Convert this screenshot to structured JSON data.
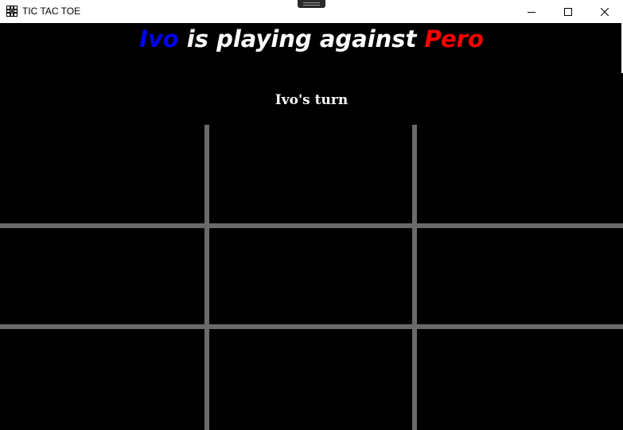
{
  "window": {
    "title": "TIC TAC TOE",
    "icon": "tic-tac-toe-grid-icon",
    "controls": [
      "minimize-icon",
      "maximize-icon",
      "close-icon"
    ]
  },
  "header": {
    "player1": "Ivo",
    "middle": " is playing against ",
    "player2": "Pero"
  },
  "status": {
    "turn_text": "Ivo's turn"
  },
  "board": {
    "cells": [
      "",
      "",
      "",
      "",
      "",
      "",
      "",
      "",
      ""
    ]
  },
  "colors": {
    "background": "#000000",
    "player1": "#0000ff",
    "player2": "#ff0000",
    "grid": "#6a6a6a",
    "text": "#ffffff"
  }
}
